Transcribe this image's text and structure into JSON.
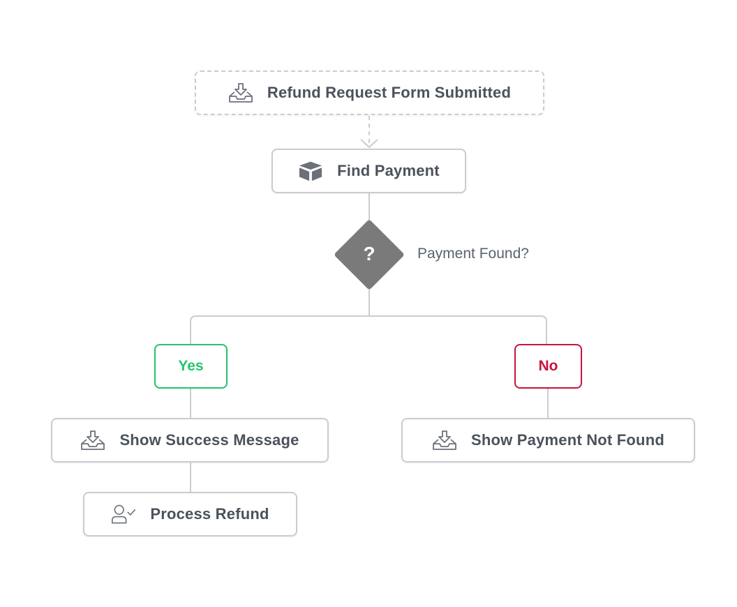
{
  "diagram": {
    "trigger": {
      "label": "Refund Request Form Submitted",
      "icon": "inbox-download-icon"
    },
    "find_payment": {
      "label": "Find Payment",
      "icon": "box-icon"
    },
    "decision": {
      "symbol": "?",
      "label": "Payment Found?"
    },
    "branches": {
      "yes": {
        "label": "Yes",
        "color": "#22c56e"
      },
      "no": {
        "label": "No",
        "color": "#c8143f"
      }
    },
    "yes_steps": [
      {
        "label": "Show Success Message",
        "icon": "inbox-download-icon"
      },
      {
        "label": "Process Refund",
        "icon": "user-check-icon"
      }
    ],
    "no_steps": [
      {
        "label": "Show Payment Not Found",
        "icon": "inbox-download-icon"
      }
    ],
    "colors": {
      "connector": "#c9ccd1",
      "node_text": "#4b525c",
      "decision_fill": "#7a7a7a"
    }
  }
}
